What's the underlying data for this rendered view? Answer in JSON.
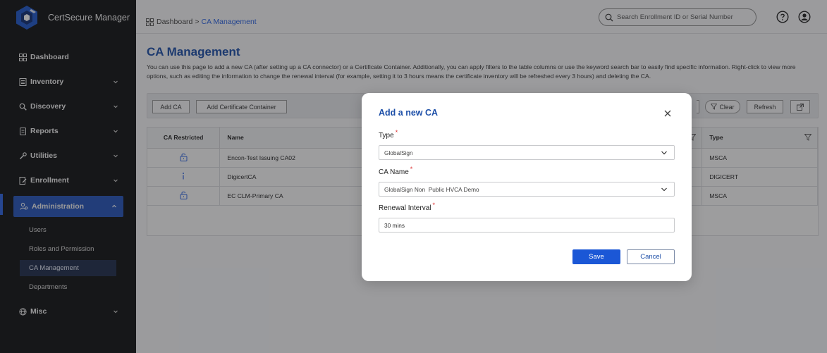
{
  "app": {
    "name": "CertSecure Manager",
    "logo_icon": "certsecure-logo-icon"
  },
  "colors": {
    "accent": "#1d4fa8",
    "primary_button": "#1b57d6",
    "sidebar_bg": "#111214",
    "active_nav": "#2553b8",
    "required": "#d33333"
  },
  "sidebar": {
    "items": [
      {
        "label": "Dashboard",
        "icon": "dashboard-icon",
        "has_chevron": false
      },
      {
        "label": "Inventory",
        "icon": "inventory-icon",
        "has_chevron": true
      },
      {
        "label": "Discovery",
        "icon": "discovery-icon",
        "has_chevron": true
      },
      {
        "label": "Reports",
        "icon": "reports-icon",
        "has_chevron": true
      },
      {
        "label": "Utilities",
        "icon": "utilities-icon",
        "has_chevron": true
      },
      {
        "label": "Enrollment",
        "icon": "enrollment-icon",
        "has_chevron": true
      },
      {
        "label": "Administration",
        "icon": "administration-icon",
        "has_chevron": true,
        "expanded": true
      }
    ],
    "administration_sub": [
      {
        "label": "Users"
      },
      {
        "label": "Roles and Permission"
      },
      {
        "label": "CA Management",
        "current": true
      },
      {
        "label": "Departments"
      }
    ],
    "misc": {
      "label": "Misc",
      "icon": "globe-icon"
    }
  },
  "header": {
    "breadcrumb_root": "Dashboard",
    "breadcrumb_separator": ">",
    "breadcrumb_current": "CA Management",
    "search_placeholder": "Search Enrollment ID or Serial Number"
  },
  "page": {
    "title": "CA Management",
    "description": "You can use this page to add a new CA (after setting up a CA connector) or a Certificate Container. Additionally, you can apply filters to the table columns or use the keyword search bar to easily find specific information. Right-click to view more options, such as editing the information to change the renewal interval (for example, setting it to 3 hours means the certificate inventory will be refreshed every 3 hours) and deleting the CA."
  },
  "toolbar": {
    "add_ca": "Add CA",
    "add_container": "Add Certificate Container",
    "clear": "Clear",
    "refresh": "Refresh"
  },
  "table": {
    "headers": {
      "restricted": "CA Restricted",
      "name": "Name",
      "type": "Type"
    },
    "rows": [
      {
        "restricted_icon": "lock-open-icon",
        "name": "Encon-Test Issuing CA02",
        "type": "MSCA"
      },
      {
        "restricted_icon": "info-icon",
        "name": "DigicertCA",
        "type": "DIGICERT"
      },
      {
        "restricted_icon": "lock-open-icon",
        "name": "EC CLM-Primary CA",
        "type": "MSCA"
      }
    ]
  },
  "modal": {
    "title": "Add a new CA",
    "type_label": "Type",
    "type_value": "GlobalSign",
    "ca_name_label": "CA Name",
    "ca_name_value": "GlobalSign Non  Public HVCA Demo",
    "renewal_label": "Renewal Interval",
    "renewal_value": "30 mins",
    "required_mark": "*",
    "save": "Save",
    "cancel": "Cancel"
  }
}
